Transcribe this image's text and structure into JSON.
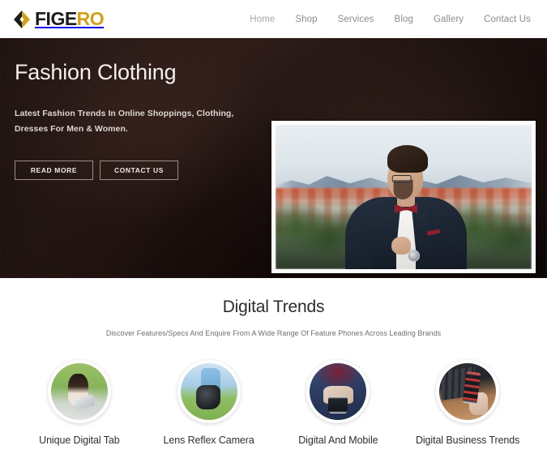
{
  "header": {
    "logo": {
      "mark": "diamond-logo-icon",
      "text_primary": "FIGE",
      "text_accent": "RO",
      "accent_color": "#d4a017",
      "primary_color": "#1b1b1b"
    },
    "nav": [
      {
        "label": "Home",
        "active": true
      },
      {
        "label": "Shop",
        "active": false
      },
      {
        "label": "Services",
        "active": false
      },
      {
        "label": "Blog",
        "active": false
      },
      {
        "label": "Gallery",
        "active": false
      },
      {
        "label": "Contact Us",
        "active": false
      }
    ]
  },
  "hero": {
    "title": "Fashion Clothing",
    "subtitle": "Latest Fashion Trends In Online Shoppings, Clothing, Dresses For Men & Women.",
    "buttons": [
      {
        "label": "READ MORE"
      },
      {
        "label": "CONTACT US"
      }
    ],
    "image_alt": "man-in-suit-with-bowtie-photo",
    "background_color": "#2a1a17"
  },
  "trends": {
    "title": "Digital Trends",
    "subtitle": "Discover Features/Specs And Enquire From A Wide Range Of Feature Phones Across Leading Brands",
    "cards": [
      {
        "title": "Unique Digital Tab",
        "image_alt": "woman-using-tablet-photo"
      },
      {
        "title": "Lens Reflex Camera",
        "image_alt": "hand-holding-camera-photo"
      },
      {
        "title": "Digital And Mobile",
        "image_alt": "hands-holding-smartphone-photo"
      },
      {
        "title": "Digital Business Trends",
        "image_alt": "hand-with-phone-over-keyboard-photo"
      }
    ]
  }
}
